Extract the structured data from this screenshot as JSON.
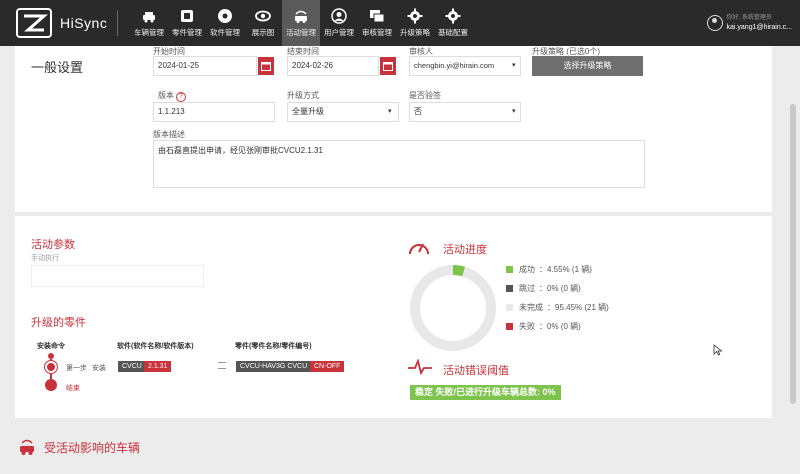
{
  "app": {
    "brand": "HiSync"
  },
  "nav": [
    {
      "label": "车辆管理",
      "icon": "car-icon"
    },
    {
      "label": "零件管理",
      "icon": "part-icon"
    },
    {
      "label": "软件管理",
      "icon": "disc-icon"
    },
    {
      "label": "展示图",
      "icon": "eye-icon"
    },
    {
      "label": "活动管理",
      "icon": "activity-car-icon",
      "active": true
    },
    {
      "label": "用户管理",
      "icon": "user-icon"
    },
    {
      "label": "审核管理",
      "icon": "review-icon"
    },
    {
      "label": "升级策略",
      "icon": "gear-icon"
    },
    {
      "label": "基础配置",
      "icon": "config-gear-icon"
    }
  ],
  "user": {
    "sub": "你好, 系统管理员",
    "name": "kai.yang1@hirain.c..."
  },
  "general": {
    "title": "一般设置",
    "start_label": "开始时间",
    "start_value": "2024-01-25",
    "end_label": "结束时间",
    "end_value": "2024-02-26",
    "reviewer_label": "审核人",
    "reviewer_value": "chengbin.yi@hirain.com",
    "strategy_label": "升级策略 (已选0个)",
    "strategy_button": "选择升级策略",
    "version_label": "版本",
    "version_value": "1.1.213",
    "mode_label": "升级方式",
    "mode_value": "全量升级",
    "verify_label": "是否验签",
    "verify_value": "否",
    "desc_label": "版本描述",
    "desc_value": "由石磊直提出申请，经见张刚审批CVCU2.1.31"
  },
  "params": {
    "title": "活动参数",
    "sub": "手动执行"
  },
  "parts": {
    "title": "升级的零件",
    "col_cmd": "安装命令",
    "col_sw": "软件(软件名称/软件版本)",
    "col_part": "零件(零件名称/零件编号)",
    "step1": "第一步",
    "step1_action": "安装",
    "step_end": "结束",
    "sw_name": "CVCU",
    "sw_ver": "2.1.31",
    "part_name": "CVCU-HAV3G CVCU",
    "part_no": "CN-OFF"
  },
  "progress": {
    "title": "活动进度",
    "legend": [
      {
        "label": "成功",
        "value": "：4.55% (1 辆)",
        "color": "#7dc34c"
      },
      {
        "label": "跳过",
        "value": "：0% (0 辆)",
        "color": "#555555"
      },
      {
        "label": "未完成",
        "value": "：95.45% (21 辆)",
        "color": "#e8e8e8"
      },
      {
        "label": "失败",
        "value": "：0% (0 辆)",
        "color": "#c8323a"
      }
    ]
  },
  "threshold": {
    "title": "活动错误阈值",
    "badge": "稳定   失败/已进行升级车辆总数: 0%"
  },
  "affected": {
    "title": "受活动影响的车辆"
  },
  "chart_data": {
    "type": "pie",
    "categories": [
      "成功",
      "跳过",
      "未完成",
      "失败"
    ],
    "values": [
      4.55,
      0,
      95.45,
      0
    ]
  }
}
